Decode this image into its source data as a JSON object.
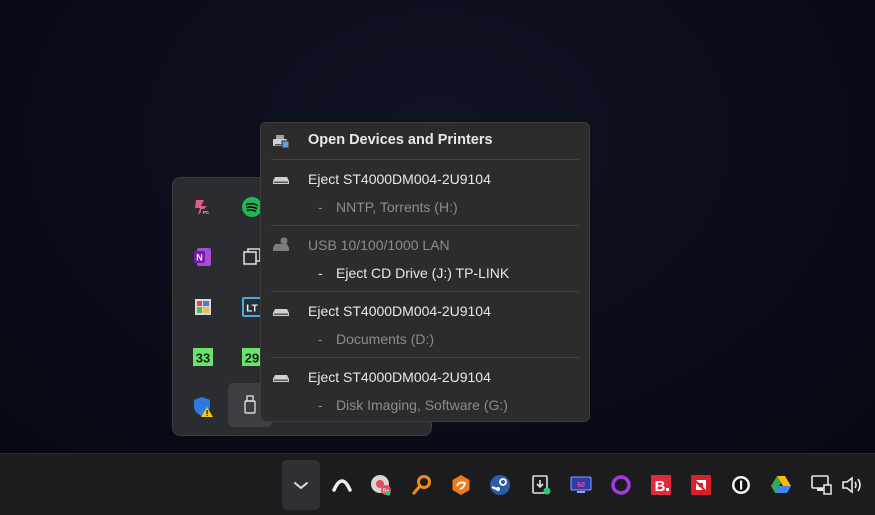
{
  "menu": {
    "header": {
      "label": "Open Devices and Printers",
      "icon": "devices-printers-icon"
    },
    "groups": [
      {
        "main": "Eject ST4000DM004-2U9104",
        "sub": "NNTP, Torrents (H:)",
        "main_enabled": true,
        "sub_enabled": false
      },
      {
        "main": "USB 10/100/1000 LAN",
        "sub": "Eject CD Drive (J:) TP-LINK",
        "main_enabled": false,
        "sub_enabled": true
      },
      {
        "main": "Eject ST4000DM004-2U9104",
        "sub": "Documents (D:)",
        "main_enabled": true,
        "sub_enabled": false
      },
      {
        "main": "Eject ST4000DM004-2U9104",
        "sub": "Disk Imaging, Software (G:)",
        "main_enabled": true,
        "sub_enabled": false
      }
    ],
    "dash": "-"
  },
  "overflow_icons": [
    {
      "name": "copilot-pc-icon",
      "color": "#e0508c"
    },
    {
      "name": "spotify-icon",
      "color": "#1db954"
    },
    {
      "name": "onenote-icon",
      "color": "#7719aa"
    },
    {
      "name": "window-copy-icon",
      "color": "#d0d0d0"
    },
    {
      "name": "palette-app-icon",
      "color": "#e8c050"
    },
    {
      "name": "lt-app-icon",
      "color": "#4aa8e8"
    },
    {
      "name": "calendar-33-icon",
      "color": "#6ee06e",
      "text": "33"
    },
    {
      "name": "calendar-29-icon",
      "color": "#6ee06e",
      "text": "29"
    },
    {
      "name": "security-warning-icon",
      "color": "#3b8fe8"
    },
    {
      "name": "usb-drive-icon",
      "color": "#d0d0d0"
    }
  ],
  "taskbar": {
    "items": [
      "chevron-up-icon",
      "arc-icon",
      "chrome-badge-icon",
      "search-key-icon",
      "firefox-like-icon",
      "steam-icon",
      "download-manager-icon",
      "monitor-60-icon",
      "ring-app-icon",
      "bitdefender-icon",
      "amd-icon",
      "one-password-icon",
      "google-drive-icon",
      "network-icon",
      "volume-icon"
    ],
    "monitor_label": "60",
    "bitdefender_label": "B"
  }
}
